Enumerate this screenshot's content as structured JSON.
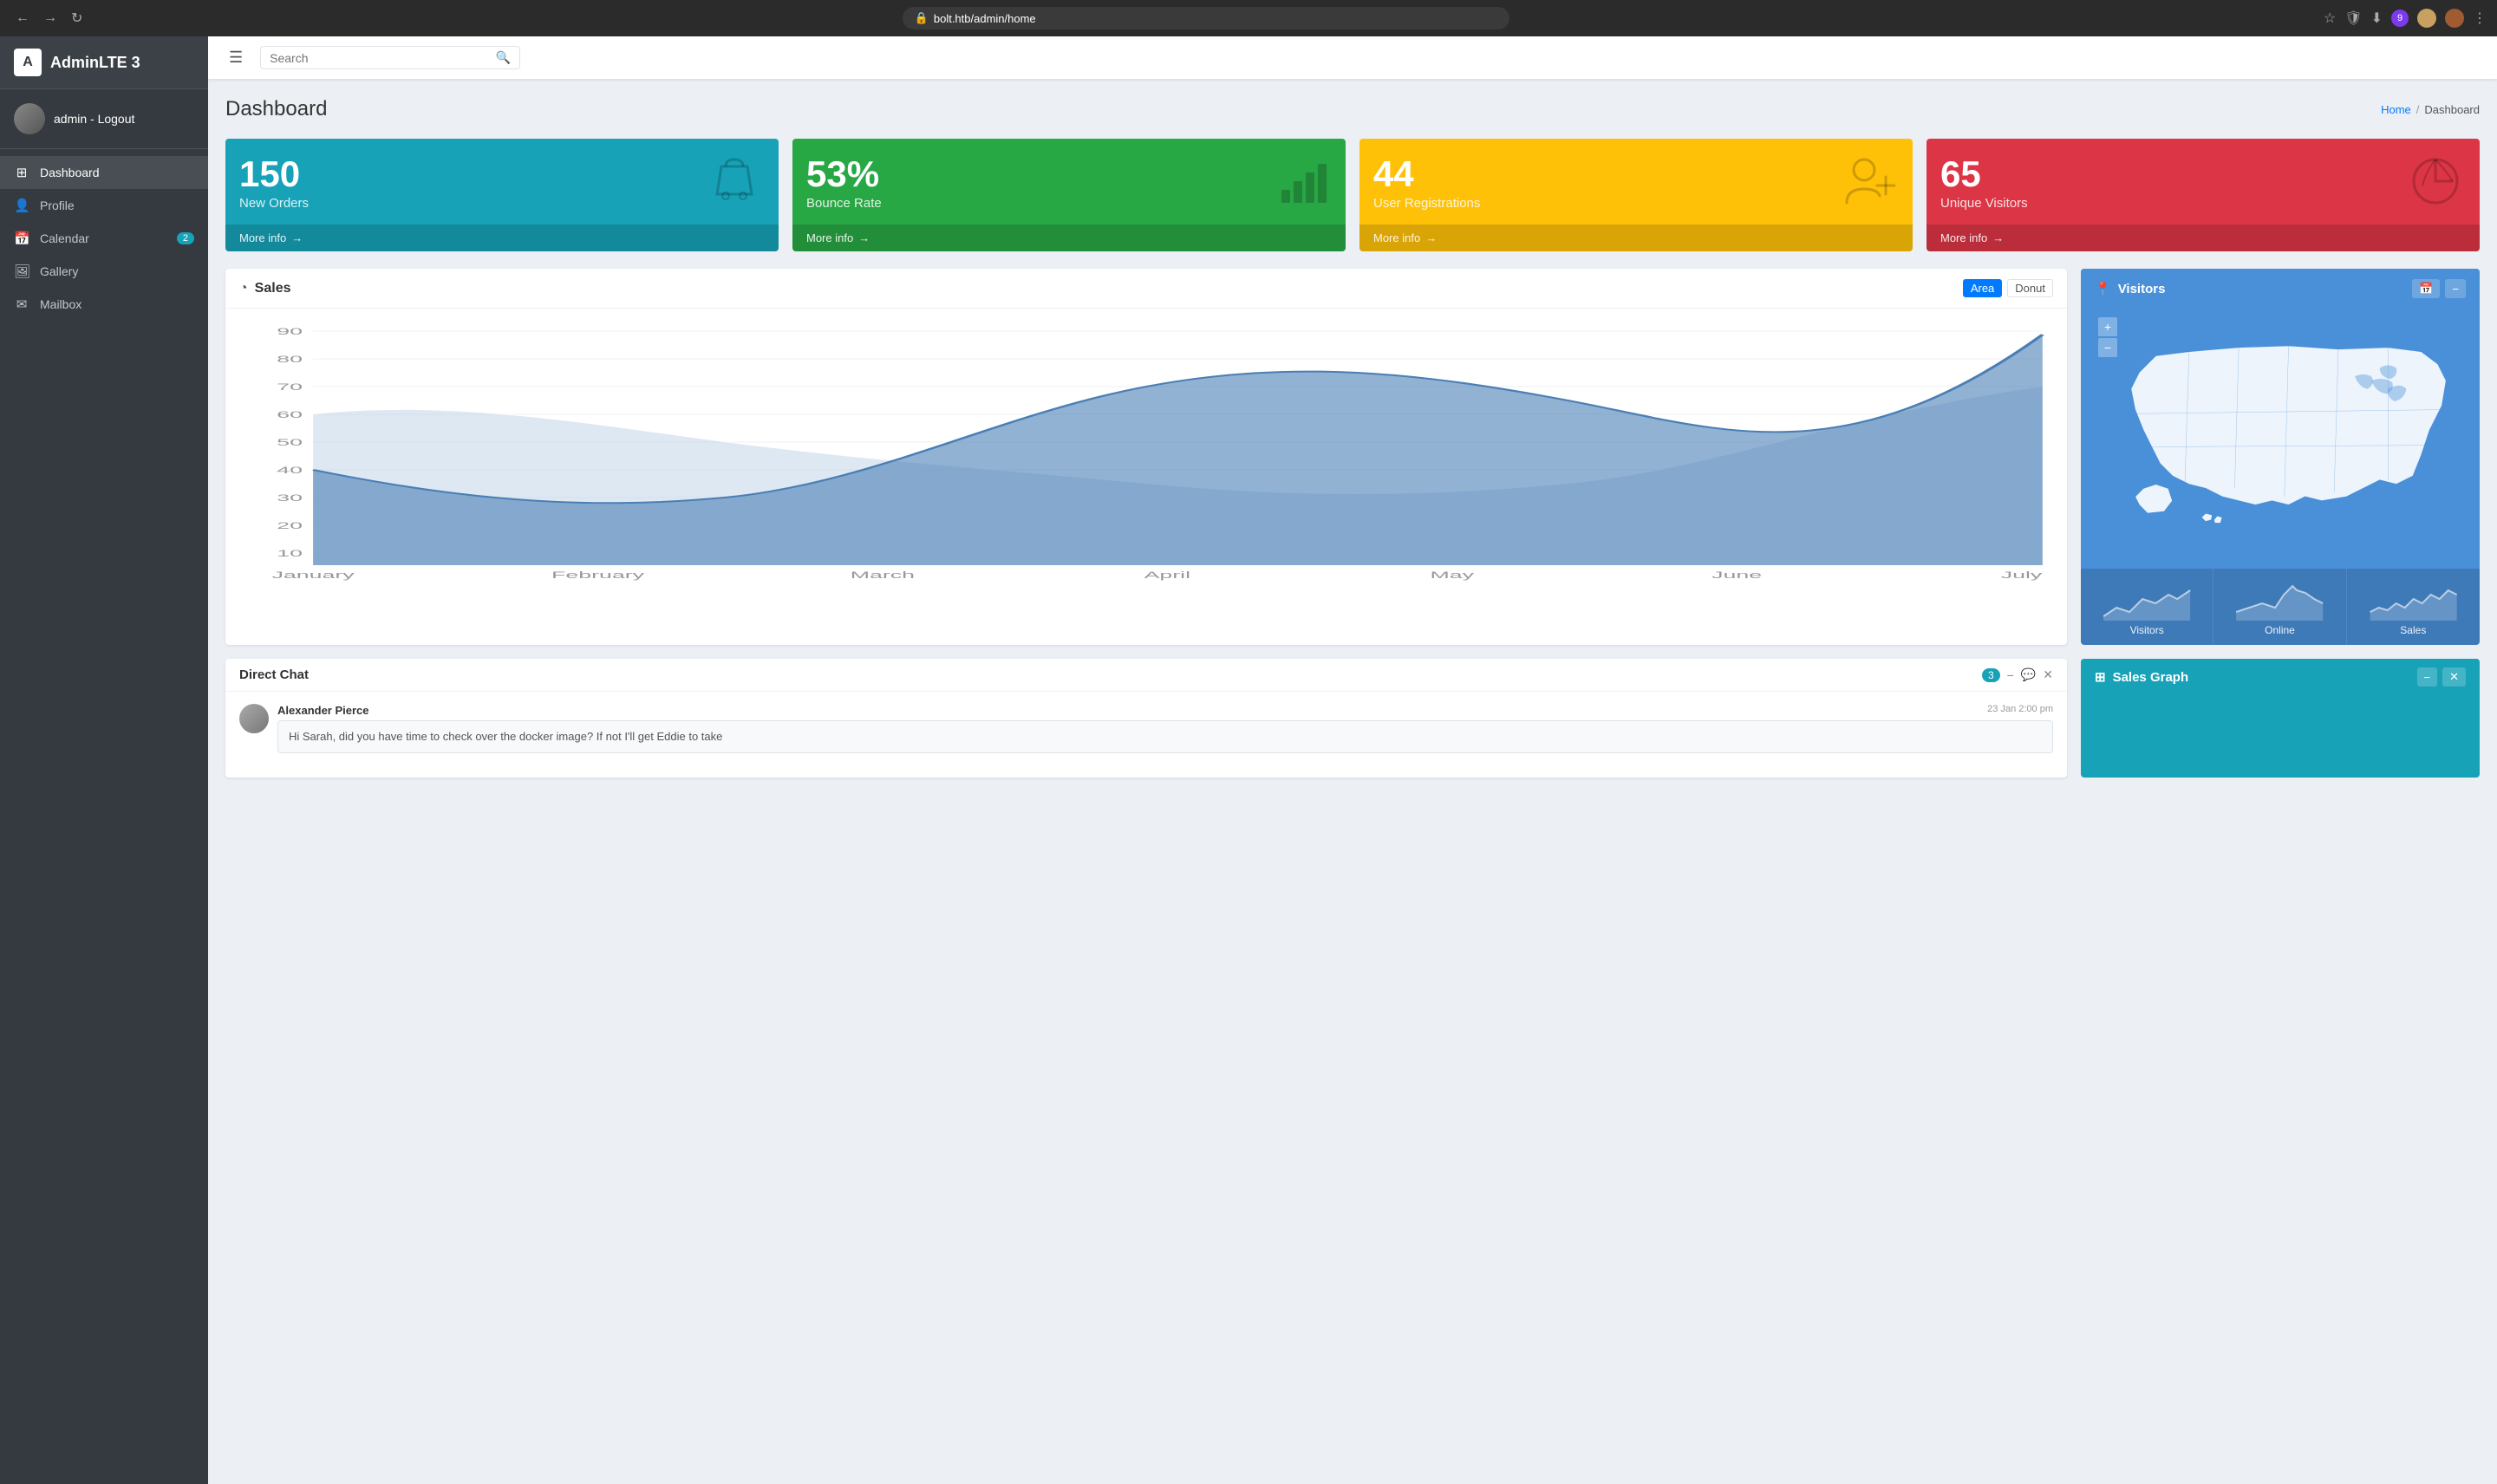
{
  "browser": {
    "url": "bolt.htb/admin/home",
    "back_btn": "←",
    "forward_btn": "→",
    "refresh_btn": "↻"
  },
  "sidebar": {
    "brand": "AdminLTE 3",
    "brand_initial": "A",
    "username": "admin - Logout",
    "items": [
      {
        "id": "dashboard",
        "label": "Dashboard",
        "icon": "⊞",
        "active": true
      },
      {
        "id": "profile",
        "label": "Profile",
        "icon": "👤",
        "active": false
      },
      {
        "id": "calendar",
        "label": "Calendar",
        "icon": "📅",
        "active": false,
        "badge": "2"
      },
      {
        "id": "gallery",
        "label": "Gallery",
        "icon": "🖼",
        "active": false
      },
      {
        "id": "mailbox",
        "label": "Mailbox",
        "icon": "✉",
        "active": false
      }
    ]
  },
  "topbar": {
    "search_placeholder": "Search",
    "search_icon": "🔍"
  },
  "page": {
    "title": "Dashboard",
    "breadcrumb_home": "Home",
    "breadcrumb_current": "Dashboard"
  },
  "info_boxes": [
    {
      "id": "orders",
      "number": "150",
      "label": "New Orders",
      "footer": "More info",
      "icon": "🛍",
      "color": "teal"
    },
    {
      "id": "bounce",
      "number": "53%",
      "label": "Bounce Rate",
      "footer": "More info",
      "icon": "📊",
      "color": "green"
    },
    {
      "id": "registrations",
      "number": "44",
      "label": "User Registrations",
      "footer": "More info",
      "icon": "👤+",
      "color": "yellow"
    },
    {
      "id": "visitors",
      "number": "65",
      "label": "Unique Visitors",
      "footer": "More info",
      "icon": "🥧",
      "color": "red"
    }
  ],
  "sales_card": {
    "title": "Sales",
    "title_icon": "◔",
    "btn_area": "Area",
    "btn_donut": "Donut",
    "y_labels": [
      "90",
      "80",
      "70",
      "60",
      "50",
      "40",
      "30",
      "20",
      "10"
    ],
    "x_labels": [
      "January",
      "February",
      "March",
      "April",
      "May",
      "June",
      "July"
    ]
  },
  "visitors_card": {
    "title": "Visitors",
    "title_icon": "📍",
    "footer_items": [
      {
        "label": "Visitors"
      },
      {
        "label": "Online"
      },
      {
        "label": "Sales"
      }
    ]
  },
  "direct_chat": {
    "title": "Direct Chat",
    "badge": "3",
    "message": {
      "author": "Alexander Pierce",
      "time": "23 Jan 2:00 pm",
      "text": "Hi Sarah, did you have time to check over the docker image? If not I'll get Eddie to take"
    }
  },
  "sales_graph": {
    "title": "Sales Graph",
    "title_icon": "⊞"
  }
}
